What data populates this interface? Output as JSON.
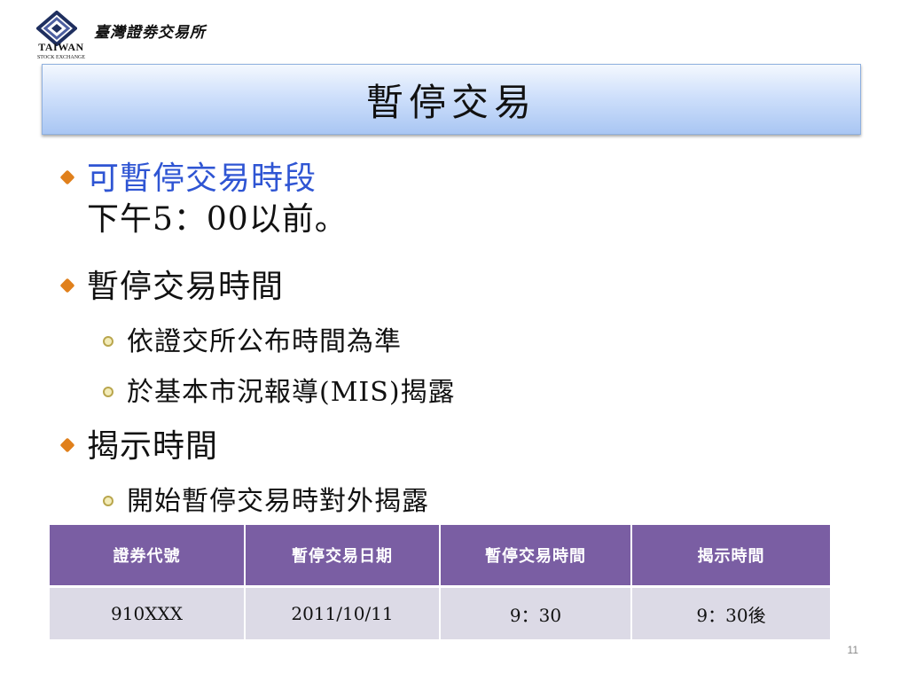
{
  "header": {
    "org_name": "臺灣證劵交易所",
    "logo_text": "TAIWAN",
    "logo_subtext": "STOCK EXCHANGE"
  },
  "title": "暫停交易",
  "bullets": [
    {
      "text": "可暫停交易時段",
      "color": "#2f55d3",
      "detail": "下午5：00以前。",
      "children": []
    },
    {
      "text": "暫停交易時間",
      "children": [
        "依證交所公布時間為準",
        "於基本市況報導(MIS)揭露"
      ]
    },
    {
      "text": "揭示時間",
      "children": [
        "開始暫停交易時對外揭露"
      ]
    }
  ],
  "table": {
    "headers": [
      "證券代號",
      "暫停交易日期",
      "暫停交易時間",
      "揭示時間"
    ],
    "rows": [
      [
        "910XXX",
        "2011/10/11",
        "9：30",
        "9：30後"
      ]
    ],
    "header_color": "#7a5ea3",
    "row_color": "#dcdae6"
  },
  "page_number": "11",
  "colors": {
    "bullet_diamond": "#e0801c",
    "accent_blue": "#2f55d3"
  }
}
